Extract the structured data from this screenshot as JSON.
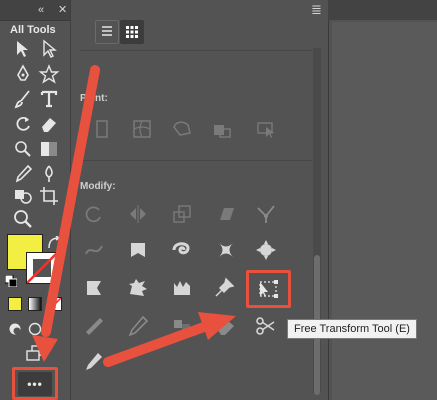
{
  "toolbar": {
    "collapse_glyph": "«",
    "close_glyph": "✕",
    "more_tools_label": "•••"
  },
  "drawer": {
    "title": "All Tools",
    "sections": [
      {
        "label": "Paint:"
      },
      {
        "label": "Modify:"
      }
    ]
  },
  "panel_menu_glyph": "≣",
  "tooltip": {
    "text": "Free Transform Tool (E)"
  },
  "colors": {
    "fill": "#f2ee42",
    "stroke": "#ffffff",
    "highlight": "#e8513d",
    "panel": "#535353"
  },
  "icons": {
    "toolbar": [
      "selection-icon",
      "direct-selection-icon",
      "pen-icon",
      "star-icon",
      "brush-icon",
      "type-icon",
      "rotate-icon",
      "eraser-icon",
      "gradient-icon",
      "paint-bucket-icon",
      "eyedropper-icon",
      "puppet-warp-icon",
      "shape-builder-icon",
      "artboard-icon",
      "zoom-icon",
      "swap-colors-icon",
      "default-colors-icon",
      "color-mode-icon",
      "gradient-mode-icon",
      "none-mode-icon",
      "draw-mode-icon",
      "screen-mode-icon",
      "change-screen-mode-icon"
    ],
    "paint_row": [
      "paintbrush-icon",
      "mesh-icon",
      "gradient-wrap-icon",
      "live-paint-icon",
      "live-paint-select-icon"
    ],
    "modify_row1": [
      "rotate-tool-icon",
      "reflect-icon",
      "scale-icon",
      "shear-icon",
      "reshape-icon"
    ],
    "modify_row2": [
      "width-icon",
      "warp-icon",
      "twirl-icon",
      "pucker-icon",
      "bloat-icon"
    ],
    "modify_row3": [
      "scallop-icon",
      "crystallize-icon",
      "wrinkle-icon",
      "puppet-pin-icon",
      "free-transform-icon"
    ],
    "modify_row4": [
      "measure-icon",
      "eyedropper-modify-icon",
      "blend-icon",
      "eraser-modify-icon",
      "scissors-icon"
    ],
    "modify_row5": [
      "color-picker-icon"
    ]
  }
}
